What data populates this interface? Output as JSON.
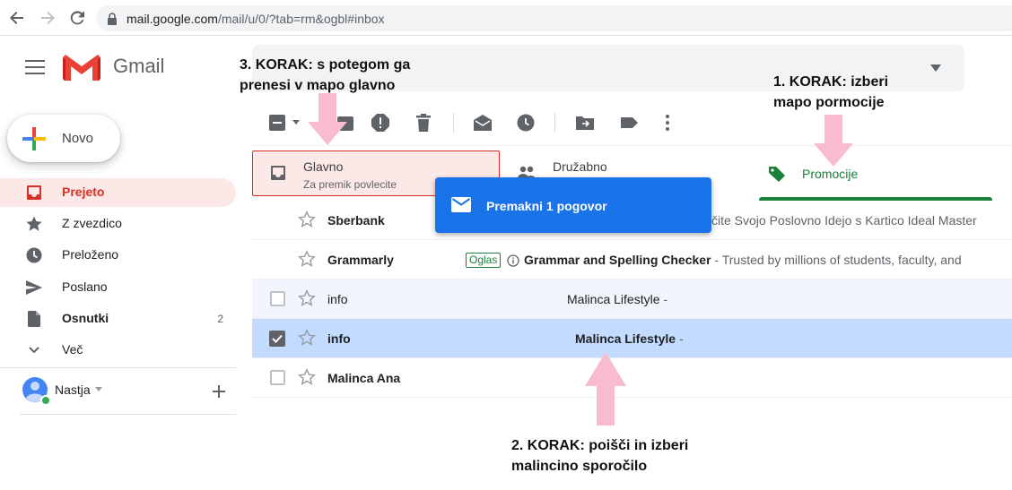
{
  "browser": {
    "url_host": "mail.google.com",
    "url_path": "/mail/u/0/?tab=rm&ogbl#inbox"
  },
  "app": {
    "name": "Gmail"
  },
  "sidebar": {
    "compose_label": "Novo",
    "items": [
      {
        "label": "Prejeto",
        "icon": "inbox-icon",
        "active": true
      },
      {
        "label": "Z zvezdico",
        "icon": "star-icon"
      },
      {
        "label": "Preloženo",
        "icon": "clock-icon"
      },
      {
        "label": "Poslano",
        "icon": "send-icon"
      },
      {
        "label": "Osnutki",
        "icon": "draft-icon",
        "count": "2"
      },
      {
        "label": "Več",
        "icon": "chevron-down-icon"
      }
    ],
    "user": {
      "name": "Nastja"
    }
  },
  "tabs": [
    {
      "title": "Glavno",
      "subtitle": "Za premik povlecite"
    },
    {
      "title": "Družabno"
    },
    {
      "title": "Promocije",
      "color": "#188038"
    }
  ],
  "drag_tooltip": {
    "label": "Premakni 1 pogovor"
  },
  "rows": [
    {
      "sender": "Sberbank",
      "subject": "čite Svojo Poslovno Idejo s Kartico Ideal Master"
    },
    {
      "sender": "Grammarly",
      "ad_badge": "Oglas",
      "subject": "Grammar and Spelling Checker",
      "snippet": " - Trusted by millions of students, faculty, and"
    },
    {
      "sender": "info",
      "subject": "Malinca Lifestyle",
      "snippet": " -"
    },
    {
      "sender": "info",
      "subject": "Malinca Lifestyle",
      "snippet": " -",
      "selected": true
    },
    {
      "sender": "Malinca Ana",
      "subject": ""
    }
  ],
  "annotations": {
    "step1": [
      "1. KORAK: izberi",
      "mapo pormocije"
    ],
    "step2": [
      "2. KORAK: poišči in izberi",
      "malincino sporočilo"
    ],
    "step3": [
      "3. KORAK: s potegom ga",
      "prenesi v mapo glavno"
    ]
  },
  "colors": {
    "accent_red": "#d93025",
    "active_bg": "#fce8e6",
    "promo_green": "#188038",
    "selected_row": "#c2dbff",
    "tooltip_blue": "#1a73e8",
    "arrow_pink": "#f8bbd0"
  }
}
